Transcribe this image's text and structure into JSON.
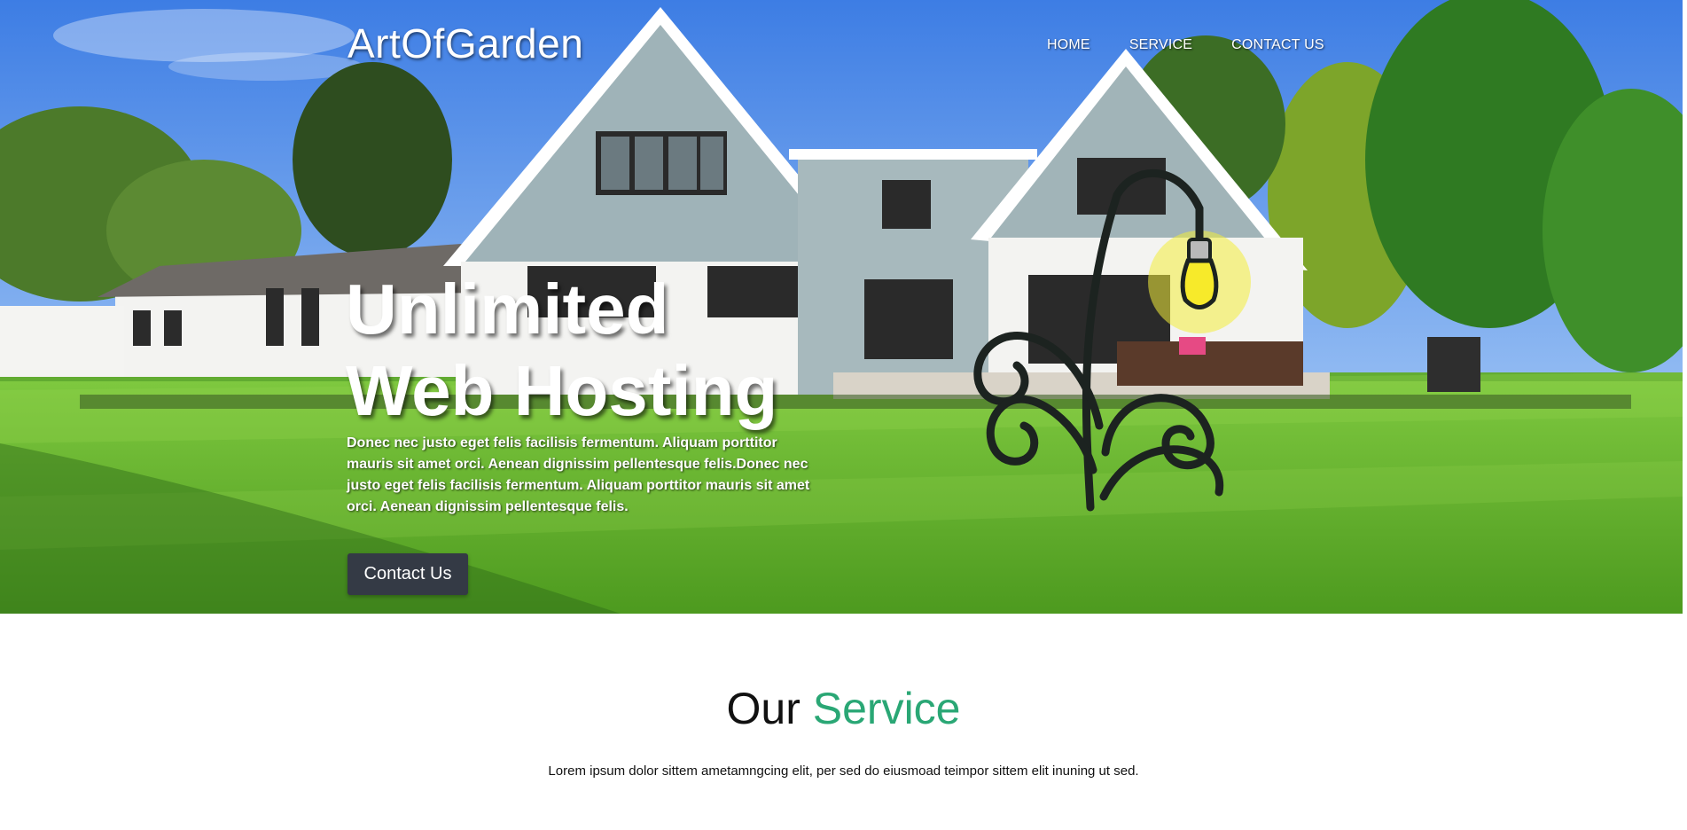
{
  "site": {
    "brand": "ArtOfGarden"
  },
  "nav": {
    "items": [
      {
        "label": "HOME"
      },
      {
        "label": "SERVICE"
      },
      {
        "label": "CONTACT US"
      }
    ]
  },
  "hero": {
    "title_line1": "Unlimited",
    "title_line2": "Web Hosting",
    "text": "Donec nec justo eget felis facilisis fermentum. Aliquam porttitor mauris sit amet orci. Aenean dignissim pellentesque felis.Donec nec justo eget felis facilisis fermentum. Aliquam porttitor mauris sit amet orci. Aenean dignissim pellentesque felis.",
    "button_label": "Contact Us"
  },
  "service": {
    "title_prefix": "Our",
    "title_accent": "Service",
    "text": "Lorem ipsum dolor sittem ametamngcing elit, per sed do eiusmoad teimpor sittem elit inuning ut sed."
  },
  "colors": {
    "accent": "#2aa775",
    "button_bg": "#343a45",
    "lamp_bulb": "#f7ea2a"
  },
  "icons": {
    "hero_illustration": "lamp-plant-icon"
  }
}
